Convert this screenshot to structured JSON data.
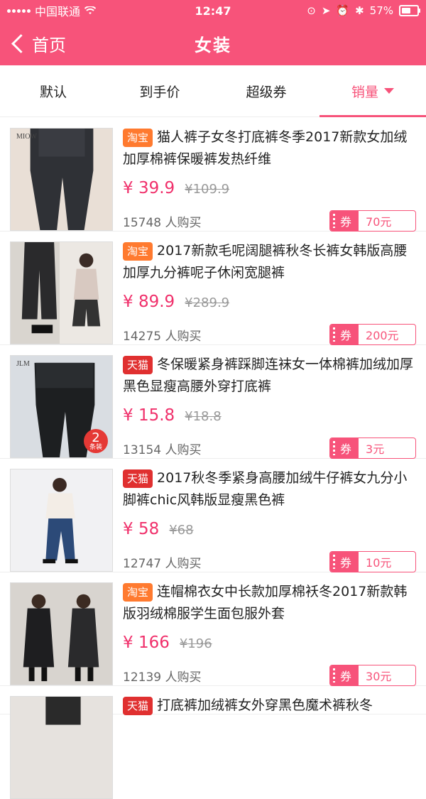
{
  "status": {
    "carrier": "中国联通",
    "time": "12:47",
    "battery": "57%"
  },
  "header": {
    "back_label": "首页",
    "title": "女装"
  },
  "tabs": [
    {
      "label": "默认"
    },
    {
      "label": "到手价"
    },
    {
      "label": "超级券"
    },
    {
      "label": "销量",
      "active": true
    }
  ],
  "products": [
    {
      "platform": "淘宝",
      "title": "猫人裤子女冬打底裤冬季2017新款女加绒加厚棉裤保暖裤发热纤维",
      "price": "¥ 39.9",
      "original_price": "¥109.9",
      "buyers": "15748 人购买",
      "coupon_label": "券",
      "coupon_value": "70元",
      "thumb_brand": "MIOW"
    },
    {
      "platform": "淘宝",
      "title": "2017新款毛呢阔腿裤秋冬长裤女韩版高腰加厚九分裤呢子休闲宽腿裤",
      "price": "¥ 89.9",
      "original_price": "¥289.9",
      "buyers": "14275 人购买",
      "coupon_label": "券",
      "coupon_value": "200元"
    },
    {
      "platform": "天猫",
      "title": "冬保暖紧身裤踩脚连袜女一体棉裤加绒加厚黑色显瘦高腰外穿打底裤",
      "price": "¥ 15.8",
      "original_price": "¥18.8",
      "buyers": "13154 人购买",
      "coupon_label": "券",
      "coupon_value": "3元",
      "thumb_brand": "JLM",
      "thumb_corner_num": "2",
      "thumb_corner_text": "条装"
    },
    {
      "platform": "天猫",
      "title": "2017秋冬季紧身高腰加绒牛仔裤女九分小脚裤chic风韩版显瘦黑色裤",
      "price": "¥ 58",
      "original_price": "¥68",
      "buyers": "12747 人购买",
      "coupon_label": "券",
      "coupon_value": "10元"
    },
    {
      "platform": "淘宝",
      "title": "连帽棉衣女中长款加厚棉袄冬2017新款韩版羽绒棉服学生面包服外套",
      "price": "¥ 166",
      "original_price": "¥196",
      "buyers": "12139 人购买",
      "coupon_label": "券",
      "coupon_value": "30元"
    },
    {
      "platform": "天猫",
      "title": "打底裤加绒裤女外穿黑色魔术裤秋冬"
    }
  ],
  "colors": {
    "accent": "#f7537a",
    "price": "#f0306b",
    "taobao": "#ff7a2f",
    "tmall": "#e03030"
  }
}
